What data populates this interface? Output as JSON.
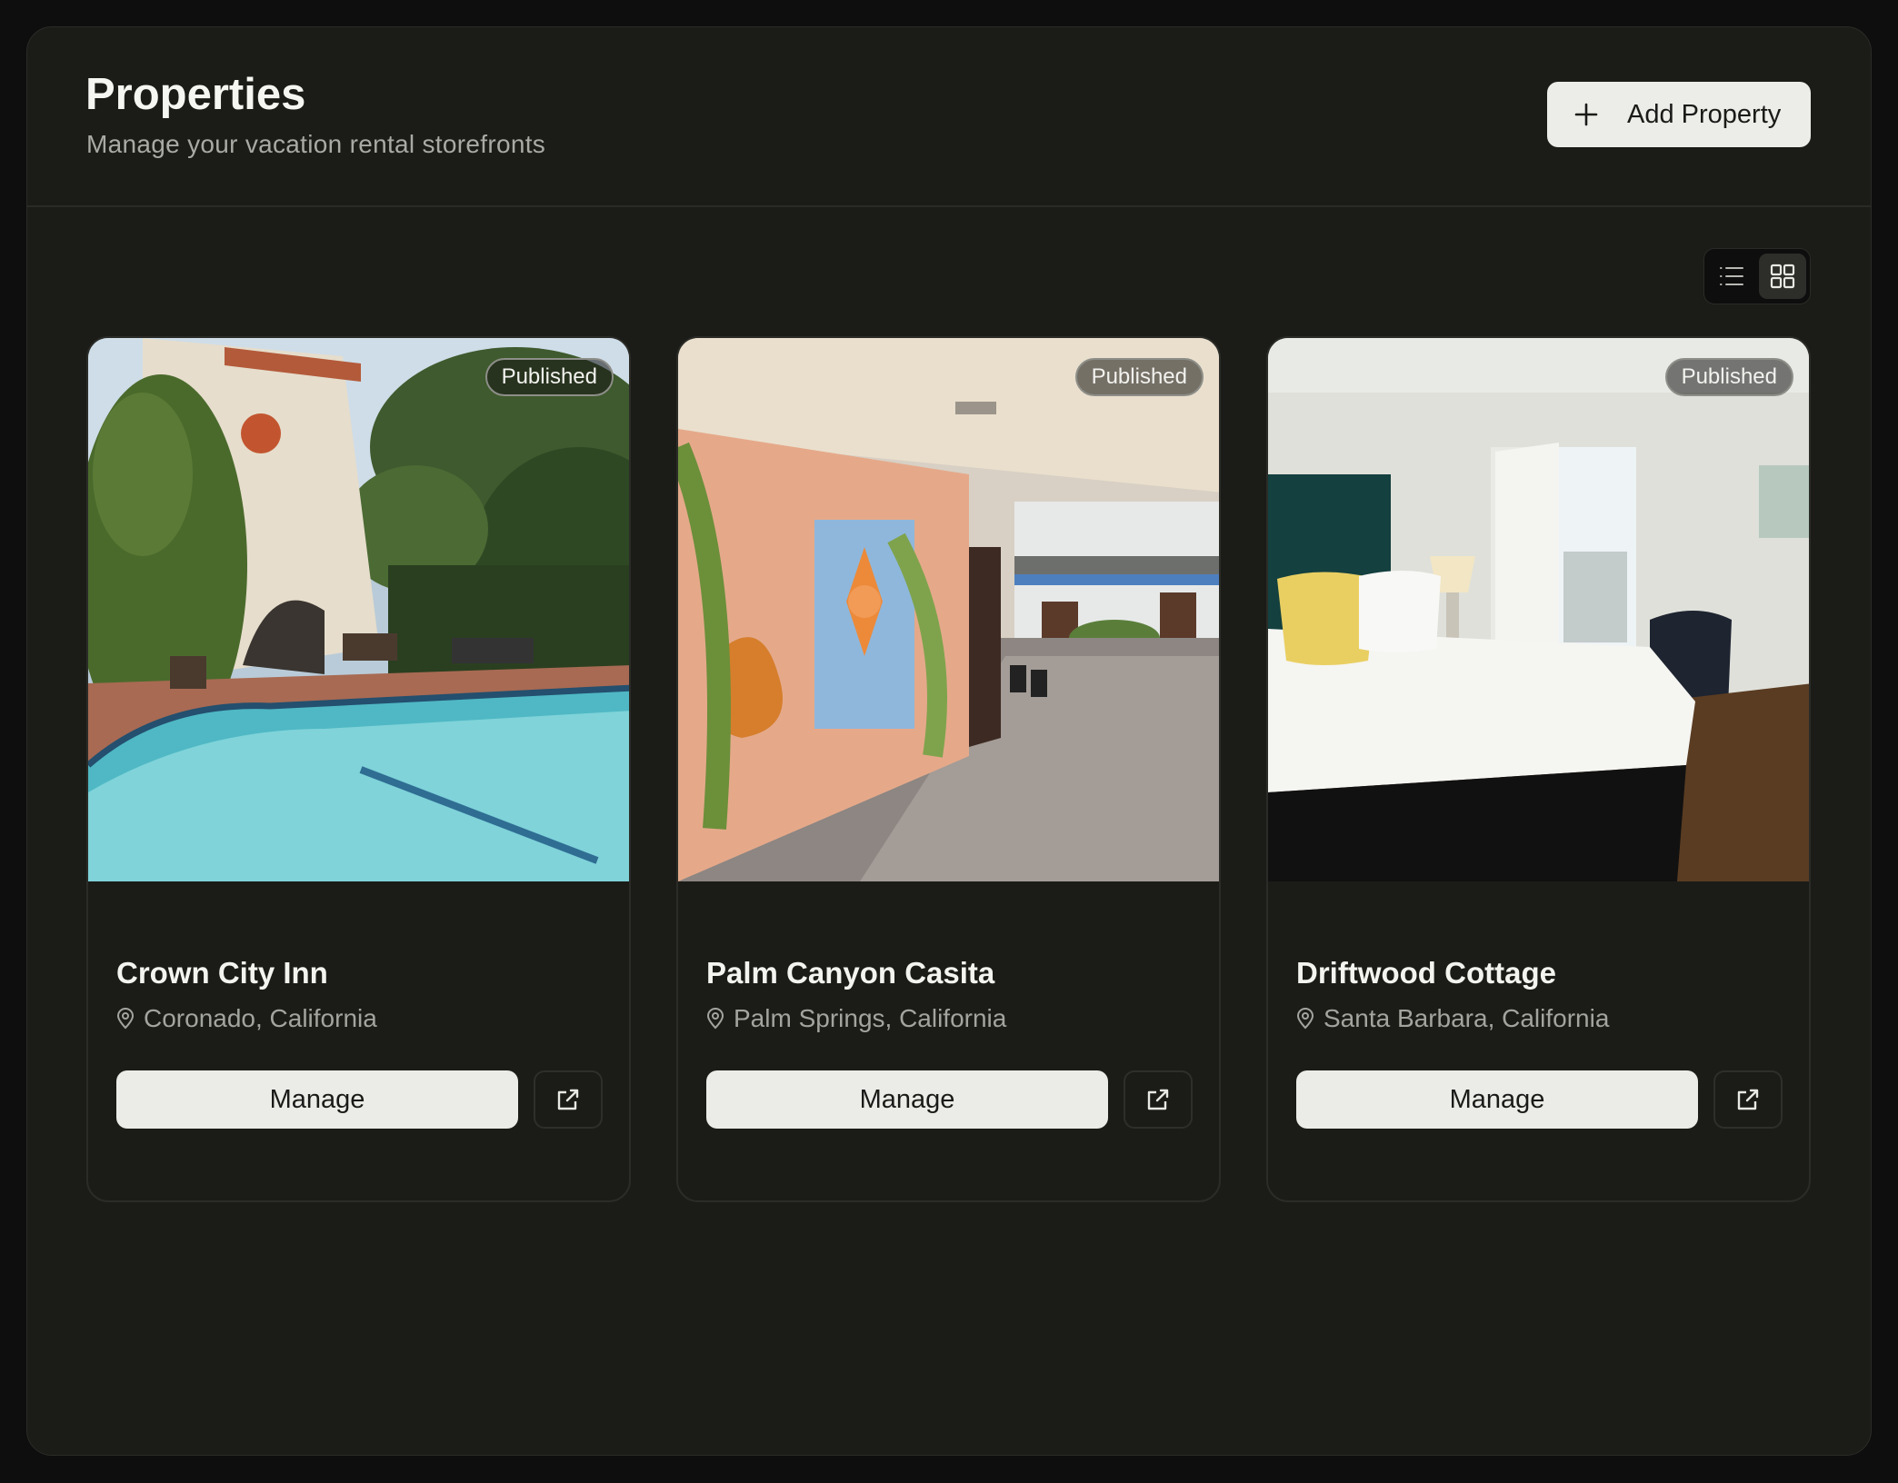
{
  "header": {
    "title": "Properties",
    "subtitle": "Manage your vacation rental storefronts",
    "add_button_label": "Add Property",
    "add_icon": "plus-icon"
  },
  "view_toggle": {
    "options": [
      "list-view-icon",
      "grid-view-icon"
    ],
    "selected": "grid"
  },
  "properties": [
    {
      "name": "Crown City Inn",
      "location": "Coronado, California",
      "status": "Published",
      "photo_subject": "pool-courtyard",
      "manage_label": "Manage",
      "open_icon": "external-link-icon"
    },
    {
      "name": "Palm Canyon Casita",
      "location": "Palm Springs, California",
      "status": "Published",
      "photo_subject": "mural-carport",
      "manage_label": "Manage",
      "open_icon": "external-link-icon"
    },
    {
      "name": "Driftwood Cottage",
      "location": "Santa Barbara, California",
      "status": "Published",
      "photo_subject": "bedroom",
      "manage_label": "Manage",
      "open_icon": "external-link-icon"
    }
  ],
  "colors": {
    "background": "#0d0e0d",
    "panel": "#1b1c18",
    "button_light": "#ebebe7",
    "muted_text": "#a3a49e"
  }
}
